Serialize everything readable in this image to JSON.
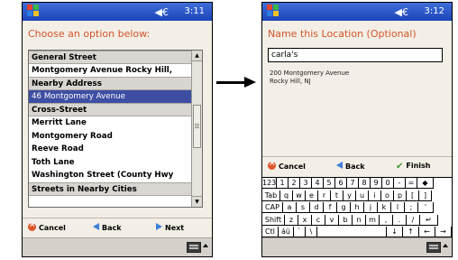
{
  "left": {
    "clock": "3:11",
    "heading": "Choose an option below:",
    "list": [
      {
        "label": "General Street",
        "kind": "header"
      },
      {
        "label": "Montgomery Avenue  Rocky Hill,",
        "kind": "item"
      },
      {
        "label": "Nearby Address",
        "kind": "header"
      },
      {
        "label": "46 Montgomery Avenue",
        "kind": "selected"
      },
      {
        "label": "Cross-Street",
        "kind": "header"
      },
      {
        "label": "Merritt Lane",
        "kind": "item"
      },
      {
        "label": "Montgomery Road",
        "kind": "item"
      },
      {
        "label": "Reeve Road",
        "kind": "item"
      },
      {
        "label": "Toth Lane",
        "kind": "item"
      },
      {
        "label": "Washington Street (County Hwy",
        "kind": "item"
      },
      {
        "label": "Streets in Nearby Cities",
        "kind": "header"
      }
    ],
    "commands": {
      "cancel": "Cancel",
      "back": "Back",
      "next": "Next"
    }
  },
  "right": {
    "clock": "3:12",
    "heading": "Name this Location (Optional)",
    "input_value": "carla's",
    "address_line1": "200 Montgomery Avenue",
    "address_line2": "Rocky Hill, NJ",
    "commands": {
      "cancel": "Cancel",
      "back": "Back",
      "finish": "Finish"
    },
    "keyboard": [
      [
        "123",
        "1",
        "2",
        "3",
        "4",
        "5",
        "6",
        "7",
        "8",
        "9",
        "0",
        "-",
        "=",
        "◆"
      ],
      [
        "Tab",
        "q",
        "w",
        "e",
        "r",
        "t",
        "y",
        "u",
        "i",
        "o",
        "p",
        "[",
        "]"
      ],
      [
        "CAP",
        "a",
        "s",
        "d",
        "f",
        "g",
        "h",
        "j",
        "k",
        "l",
        ";",
        "'"
      ],
      [
        "Shift",
        "z",
        "x",
        "c",
        "v",
        "b",
        "n",
        "m",
        ",",
        ".",
        "/",
        "↵"
      ],
      [
        "Ctl",
        "áü",
        "`",
        "\\",
        "",
        "↓",
        "↑",
        "←",
        "→"
      ]
    ]
  }
}
